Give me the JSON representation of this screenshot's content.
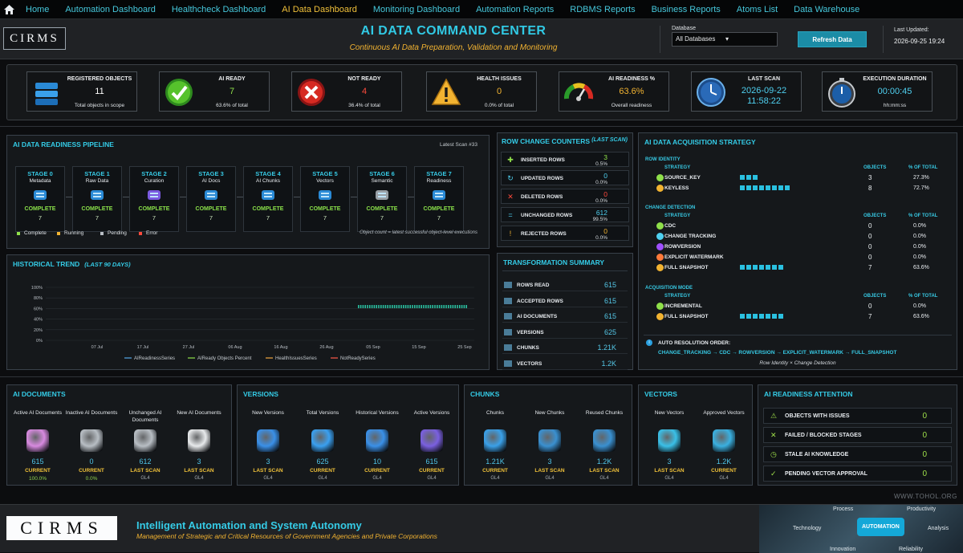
{
  "nav": {
    "home_icon": "home-icon",
    "items": [
      {
        "label": "Home",
        "active": false
      },
      {
        "label": "Automation Dashboard",
        "active": false
      },
      {
        "label": "Healthcheck Dashboard",
        "active": false
      },
      {
        "label": "AI Data Dashboard",
        "active": true
      },
      {
        "label": "Monitoring Dashboard",
        "active": false
      },
      {
        "label": "Automation Reports",
        "active": false
      },
      {
        "label": "RDBMS Reports",
        "active": false
      },
      {
        "label": "Business Reports",
        "active": false
      },
      {
        "label": "Atoms List",
        "active": false
      },
      {
        "label": "Data Warehouse",
        "active": false
      }
    ]
  },
  "header": {
    "logo_text": "CIRMS",
    "title": "AI DATA COMMAND CENTER",
    "subtitle": "Continuous AI Data Preparation, Validation and Monitoring",
    "database_label": "Database",
    "database_value": "All Databases",
    "refresh_label": "Refresh Data",
    "last_updated_label": "Last Updated:",
    "last_updated_value": "2026-09-25 19:24"
  },
  "kpis": [
    {
      "title": "REGISTERED OBJECTS",
      "value": "11",
      "sub": "Total objects in scope",
      "color": "#ffffff",
      "icon": "database-icon"
    },
    {
      "title": "AI READY",
      "value": "7",
      "sub": "63.6% of total",
      "color": "#8fe04a",
      "icon": "checkmark-icon"
    },
    {
      "title": "NOT READY",
      "value": "4",
      "sub": "36.4% of total",
      "color": "#ff4a3c",
      "icon": "error-x-icon"
    },
    {
      "title": "HEALTH ISSUES",
      "value": "0",
      "sub": "0.0% of total",
      "color": "#f2b331",
      "icon": "warning-icon"
    },
    {
      "title": "AI READINESS %",
      "value": "63.6%",
      "sub": "Overall readiness",
      "color": "#f2b331",
      "icon": "gauge-icon"
    },
    {
      "title": "LAST SCAN",
      "value": "2026-09-22",
      "value2": "11:58:22",
      "sub": "",
      "color": "#4fd0f0",
      "icon": "clock-icon"
    },
    {
      "title": "EXECUTION DURATION",
      "value": "00:00:45",
      "sub": "hh:mm:ss",
      "color": "#4fd0f0",
      "icon": "stopwatch-icon"
    }
  ],
  "pipeline": {
    "title": "AI DATA READINESS PIPELINE",
    "latest_scan": "Latest Scan #33",
    "stages": [
      {
        "name": "STAGE 0",
        "desc": "Metadata",
        "status": "COMPLETE",
        "count": "7"
      },
      {
        "name": "STAGE 1",
        "desc": "Raw Data",
        "status": "COMPLETE",
        "count": "7"
      },
      {
        "name": "STAGE 2",
        "desc": "Curation",
        "status": "COMPLETE",
        "count": "7"
      },
      {
        "name": "STAGE 3",
        "desc": "AI Docs",
        "status": "COMPLETE",
        "count": "7"
      },
      {
        "name": "STAGE 4",
        "desc": "AI Chunks",
        "status": "COMPLETE",
        "count": "7"
      },
      {
        "name": "STAGE 5",
        "desc": "Vectors",
        "status": "COMPLETE",
        "count": "7"
      },
      {
        "name": "STAGE 6",
        "desc": "Semantic",
        "status": "COMPLETE",
        "count": "7"
      },
      {
        "name": "STAGE 7",
        "desc": "Readiness",
        "status": "COMPLETE",
        "count": "7"
      }
    ],
    "legend": [
      {
        "label": "Complete",
        "color": "#8fe04a"
      },
      {
        "label": "Running",
        "color": "#f2b331"
      },
      {
        "label": "Pending",
        "color": "#b8bec4"
      },
      {
        "label": "Error",
        "color": "#ff4a3c"
      }
    ],
    "note": "Object count = latest successful object-level executions"
  },
  "chart_data": {
    "type": "line",
    "title": "HISTORICAL TREND",
    "title_suffix": "(LAST 90 DAYS)",
    "x": [
      "07 Jul",
      "17 Jul",
      "27 Jul",
      "06 Aug",
      "16 Aug",
      "26 Aug",
      "05 Sep",
      "15 Sep",
      "25 Sep"
    ],
    "y_ticks": [
      "100%",
      "80%",
      "60%",
      "40%",
      "20%",
      "0%"
    ],
    "ylim": [
      0,
      100
    ],
    "series": [
      {
        "name": "AIReadinessSeries",
        "color": "#54a8e8"
      },
      {
        "name": "AIReady Objects Percent",
        "color": "#8fe04a"
      },
      {
        "name": "HealthIssuesSeries",
        "color": "#f2a640"
      },
      {
        "name": "NotReadySeries",
        "color": "#ff5a4a"
      }
    ],
    "visible_segment": {
      "x_start": "01 Sep",
      "x_end": "25 Sep",
      "y": 63.6
    }
  },
  "row_change": {
    "title": "ROW CHANGE COUNTERS",
    "suffix": "(LAST SCAN)",
    "rows": [
      {
        "label": "INSERTED ROWS",
        "value": "3",
        "pct": "0.5%",
        "color": "#8fe04a",
        "icon": "plus-icon"
      },
      {
        "label": "UPDATED ROWS",
        "value": "0",
        "pct": "0.0%",
        "color": "#4fd0f0",
        "icon": "refresh-icon"
      },
      {
        "label": "DELETED ROWS",
        "value": "0",
        "pct": "0.0%",
        "color": "#ff4a3c",
        "icon": "delete-x-icon"
      },
      {
        "label": "UNCHANGED ROWS",
        "value": "612",
        "pct": "99.5%",
        "color": "#4fd0f0",
        "icon": "equals-icon"
      },
      {
        "label": "REJECTED ROWS",
        "value": "0",
        "pct": "0.0%",
        "color": "#f2b331",
        "icon": "exclamation-icon"
      }
    ]
  },
  "transformation": {
    "title": "TRANSFORMATION SUMMARY",
    "rows": [
      {
        "label": "ROWS READ",
        "value": "615"
      },
      {
        "label": "ACCEPTED ROWS",
        "value": "615"
      },
      {
        "label": "AI DOCUMENTS",
        "value": "615"
      },
      {
        "label": "VERSIONS",
        "value": "625"
      },
      {
        "label": "CHUNKS",
        "value": "1.21K"
      },
      {
        "label": "VECTORS",
        "value": "1.2K"
      }
    ]
  },
  "acquisition": {
    "title": "AI DATA ACQUISITION STRATEGY",
    "row_identity_label": "ROW IDENTITY",
    "change_detection_label": "CHANGE DETECTION",
    "acquisition_mode_label": "ACQUISITION MODE",
    "strategy_header": "STRATEGY",
    "objects_header": "OBJECTS",
    "pct_header": "% OF TOTAL",
    "row_identity": [
      {
        "label": "SOURCE_KEY",
        "objects": "3",
        "pct": "27.3%",
        "fill": 0.273,
        "color": "#8fe04a"
      },
      {
        "label": "KEYLESS",
        "objects": "8",
        "pct": "72.7%",
        "fill": 0.727,
        "color": "#f2b331"
      }
    ],
    "change_detection": [
      {
        "label": "CDC",
        "objects": "0",
        "pct": "0.0%",
        "fill": 0,
        "color": "#8fe04a"
      },
      {
        "label": "CHANGE TRACKING",
        "objects": "0",
        "pct": "0.0%",
        "fill": 0,
        "color": "#4fd0f0"
      },
      {
        "label": "ROWVERSION",
        "objects": "0",
        "pct": "0.0%",
        "fill": 0,
        "color": "#a050ff"
      },
      {
        "label": "EXPLICIT WATERMARK",
        "objects": "0",
        "pct": "0.0%",
        "fill": 0,
        "color": "#ff7a3a"
      },
      {
        "label": "FULL SNAPSHOT",
        "objects": "7",
        "pct": "63.6%",
        "fill": 0.636,
        "color": "#f2b331"
      }
    ],
    "acquisition_mode": [
      {
        "label": "INCREMENTAL",
        "objects": "0",
        "pct": "0.0%",
        "fill": 0,
        "color": "#8fe04a"
      },
      {
        "label": "FULL SNAPSHOT",
        "objects": "7",
        "pct": "63.6%",
        "fill": 0.636,
        "color": "#f2b331"
      }
    ],
    "auto_label": "AUTO RESOLUTION ORDER:",
    "auto_order": "CHANGE_TRACKING → CDC → ROWVERSION → EXPLICIT_WATERMARK → FULL_SNAPSHOT",
    "auto_note": "Row Identity × Change Detection"
  },
  "ai_documents": {
    "title": "AI DOCUMENTS",
    "cols": [
      {
        "t": "Active AI Documents",
        "v": "615",
        "st": "CURRENT",
        "p": "100.0%",
        "g": "",
        "color": "#d88ae0"
      },
      {
        "t": "Inactive AI Documents",
        "v": "0",
        "st": "CURRENT",
        "p": "0.0%",
        "g": "",
        "color": "#b8bec4"
      },
      {
        "t": "Unchanged AI Documents",
        "v": "612",
        "st": "LAST SCAN",
        "p": "",
        "g": "GL4",
        "color": "#b8bec4"
      },
      {
        "t": "New AI Documents",
        "v": "3",
        "st": "LAST SCAN",
        "p": "",
        "g": "GL4",
        "color": "#e8eaec"
      }
    ]
  },
  "versions": {
    "title": "VERSIONS",
    "cols": [
      {
        "t": "New Versions",
        "v": "3",
        "st": "LAST SCAN",
        "g": "GL4",
        "color": "#3a90e8"
      },
      {
        "t": "Total Versions",
        "v": "625",
        "st": "CURRENT",
        "g": "GL4",
        "color": "#3aa0f0"
      },
      {
        "t": "Historical Versions",
        "v": "10",
        "st": "CURRENT",
        "g": "GL4",
        "color": "#3a90e8"
      },
      {
        "t": "Active Versions",
        "v": "615",
        "st": "CURRENT",
        "g": "GL4",
        "color": "#7a60e0"
      }
    ]
  },
  "chunks": {
    "title": "CHUNKS",
    "cols": [
      {
        "t": "Chunks",
        "v": "1.21K",
        "st": "CURRENT",
        "g": "GL4",
        "color": "#3aa0e8"
      },
      {
        "t": "New Chunks",
        "v": "3",
        "st": "LAST SCAN",
        "g": "GL4",
        "color": "#3a90d0"
      },
      {
        "t": "Reused Chunks",
        "v": "1.2K",
        "st": "LAST SCAN",
        "g": "GL4",
        "color": "#3a90d0"
      }
    ]
  },
  "vectors": {
    "title": "VECTORS",
    "cols": [
      {
        "t": "New Vectors",
        "v": "3",
        "st": "LAST SCAN",
        "g": "GL4",
        "color": "#3ac0e8"
      },
      {
        "t": "Approved Vectors",
        "v": "1.2K",
        "st": "CURRENT",
        "g": "GL4",
        "color": "#3ab0e0"
      }
    ]
  },
  "attention": {
    "title": "AI READINESS ATTENTION",
    "rows": [
      {
        "label": "OBJECTS WITH ISSUES",
        "value": "0",
        "icon": "warning-icon",
        "glyph": "⚠"
      },
      {
        "label": "FAILED / BLOCKED STAGES",
        "value": "0",
        "icon": "x-icon",
        "glyph": "✕"
      },
      {
        "label": "STALE AI KNOWLEDGE",
        "value": "0",
        "icon": "clock-icon",
        "glyph": "◷"
      },
      {
        "label": "PENDING VECTOR APPROVAL",
        "value": "0",
        "icon": "check-icon",
        "glyph": "✓"
      }
    ]
  },
  "watermark": "WWW.TOHOL.ORG",
  "footer": {
    "logo_text": "CIRMS",
    "title": "Intelligent Automation and System Autonomy",
    "subtitle": "Management of Strategic and Critical Resources of Government Agencies and Private Corporations",
    "hex_labels": [
      "Process",
      "Productivity",
      "Technology",
      "AUTOMATION",
      "Analysis",
      "Innovation",
      "Reliability"
    ]
  }
}
